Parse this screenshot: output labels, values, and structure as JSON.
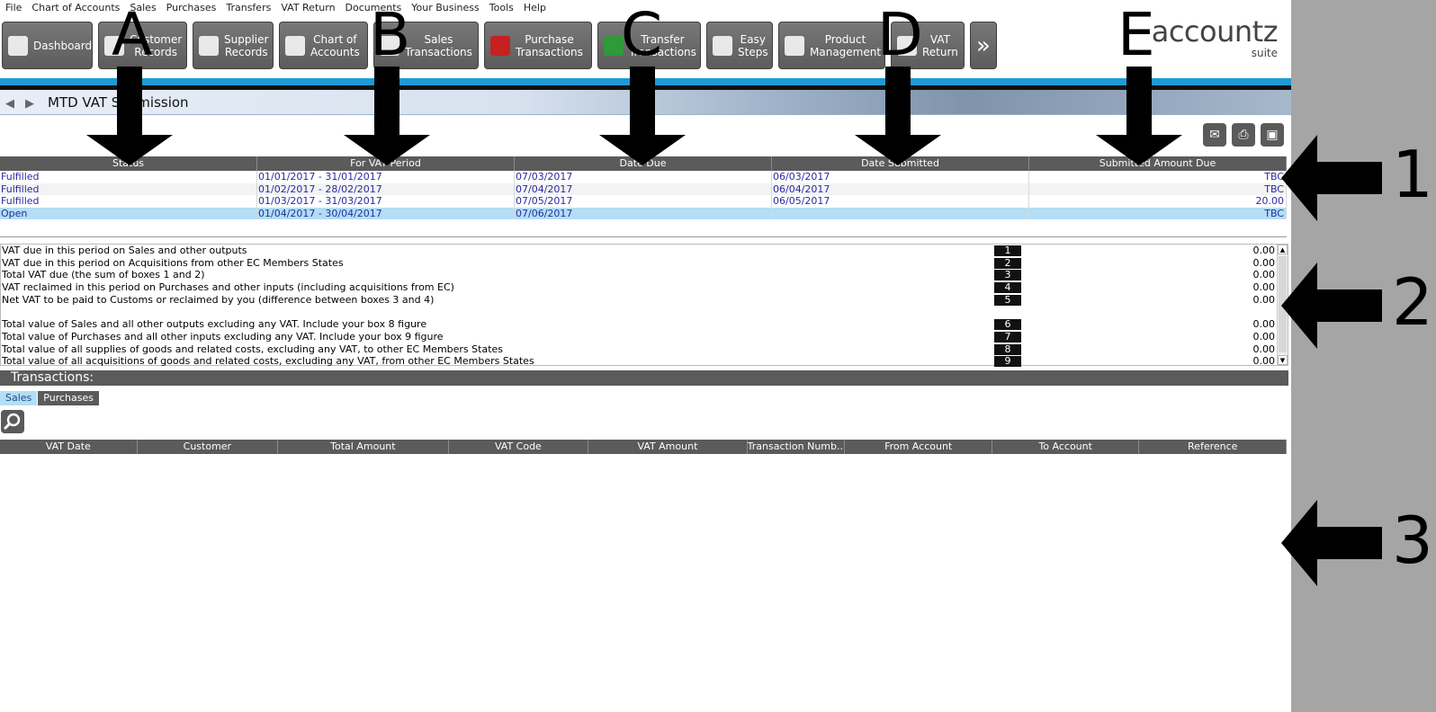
{
  "menubar": [
    "File",
    "Chart of Accounts",
    "Sales",
    "Purchases",
    "Transfers",
    "VAT Return",
    "Documents",
    "Your Business",
    "Tools",
    "Help"
  ],
  "toolbar": [
    {
      "label": "Dashboard",
      "icon": "dashboard-icon"
    },
    {
      "label": "Customer\nRecords",
      "icon": "customer-icon"
    },
    {
      "label": "Supplier\nRecords",
      "icon": "supplier-icon"
    },
    {
      "label": "Chart of\nAccounts",
      "icon": "chart-of-accounts-icon"
    },
    {
      "label": "Sales\nTransactions",
      "icon": "sales-icon"
    },
    {
      "label": "Purchase\nTransactions",
      "icon": "purchase-icon"
    },
    {
      "label": "Transfer\nTransactions",
      "icon": "transfer-icon"
    },
    {
      "label": "Easy\nSteps",
      "icon": "footsteps-icon"
    },
    {
      "label": "Product\nManagement",
      "icon": "product-box-icon"
    },
    {
      "label": "VAT\nReturn",
      "icon": "vat-return-icon"
    },
    {
      "label": "»",
      "icon": "more-chevron-icon"
    }
  ],
  "logo": {
    "brand": "accountz",
    "suite": "suite"
  },
  "page": {
    "title": "MTD VAT Submission",
    "nav_back": "🡄",
    "nav_fwd": "🡆"
  },
  "periods": {
    "columns": [
      "Status",
      "For VAT Period",
      "Date Due",
      "Date Submitted",
      "Submitted Amount Due"
    ],
    "rows": [
      [
        "Fulfilled",
        "01/01/2017 - 31/01/2017",
        "07/03/2017",
        "06/03/2017",
        "TBC"
      ],
      [
        "Fulfilled",
        "01/02/2017 - 28/02/2017",
        "07/04/2017",
        "06/04/2017",
        "TBC"
      ],
      [
        "Fulfilled",
        "01/03/2017 - 31/03/2017",
        "07/05/2017",
        "06/05/2017",
        "20.00"
      ],
      [
        "Open",
        "01/04/2017 - 30/04/2017",
        "07/06/2017",
        "",
        "TBC"
      ]
    ]
  },
  "vat_boxes": [
    {
      "text": "VAT due in this period on Sales and other outputs",
      "box": "1",
      "value": "0.00"
    },
    {
      "text": "VAT due in this period on Acquisitions from other EC Members States",
      "box": "2",
      "value": "0.00"
    },
    {
      "text": "Total VAT due (the sum of boxes 1 and 2)",
      "box": "3",
      "value": "0.00"
    },
    {
      "text": "VAT reclaimed in this period on Purchases and other inputs (including acquisitions from EC)",
      "box": "4",
      "value": "0.00"
    },
    {
      "text": "Net VAT to be paid to Customs or reclaimed by you (difference between boxes 3 and 4)",
      "box": "5",
      "value": "0.00"
    },
    {
      "text": "Total value of Sales and all other outputs excluding any VAT. Include your box 8 figure",
      "box": "6",
      "value": "0.00"
    },
    {
      "text": "Total value of Purchases and all other inputs excluding any VAT. Include your box 9 figure",
      "box": "7",
      "value": "0.00"
    },
    {
      "text": "Total value of all supplies of goods and related costs, excluding any VAT, to other EC Members States",
      "box": "8",
      "value": "0.00"
    },
    {
      "text": "Total value of all acquisitions of goods and related costs, excluding any VAT, from other EC Members States",
      "box": "9",
      "value": "0.00"
    }
  ],
  "transactions": {
    "heading": "Transactions:",
    "tabs": [
      "Sales",
      "Purchases"
    ],
    "columns": [
      "VAT Date",
      "Customer",
      "Total Amount",
      "VAT Code",
      "VAT Amount",
      "Transaction Numb...",
      "From Account",
      "To Account",
      "Reference"
    ]
  },
  "annotations": {
    "letters": [
      "A",
      "B",
      "C",
      "D",
      "E"
    ],
    "digits": [
      "1",
      "2",
      "3"
    ]
  }
}
